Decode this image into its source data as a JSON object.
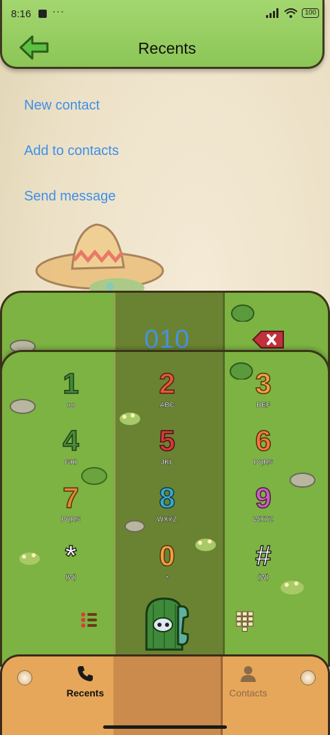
{
  "status_bar": {
    "time": "8:16",
    "more": "···",
    "battery": "100"
  },
  "header": {
    "title": "Recents",
    "back_icon": "arrow-left-icon"
  },
  "menu": {
    "new_contact": "New contact",
    "add_to_contacts": "Add to contacts",
    "send_message": "Send message"
  },
  "dialer": {
    "number": "010",
    "backspace_icon": "backspace-icon"
  },
  "keypad": {
    "keys": [
      {
        "digit": "1",
        "sub": "oo"
      },
      {
        "digit": "2",
        "sub": "ABC"
      },
      {
        "digit": "3",
        "sub": "DEF"
      },
      {
        "digit": "4",
        "sub": "GHI"
      },
      {
        "digit": "5",
        "sub": "JKL"
      },
      {
        "digit": "6",
        "sub": "PQRS"
      },
      {
        "digit": "7",
        "sub": "PQRS"
      },
      {
        "digit": "8",
        "sub": "WXYZ"
      },
      {
        "digit": "9",
        "sub": "WXYZ"
      },
      {
        "digit": "*",
        "sub": "(W)"
      },
      {
        "digit": "0",
        "sub": "+"
      },
      {
        "digit": "#",
        "sub": "(W)"
      }
    ],
    "menu_icon": "list-menu-icon",
    "call_icon": "cactus-call-icon",
    "keypad_icon": "keypad-grid-icon"
  },
  "nav": {
    "recents": "Recents",
    "contacts": "Contacts"
  },
  "colors": {
    "accent_link": "#3d8fe8",
    "bar_green": "#8cc657",
    "keypad_green": "#7cb342",
    "nav_orange": "#e7a75b"
  }
}
